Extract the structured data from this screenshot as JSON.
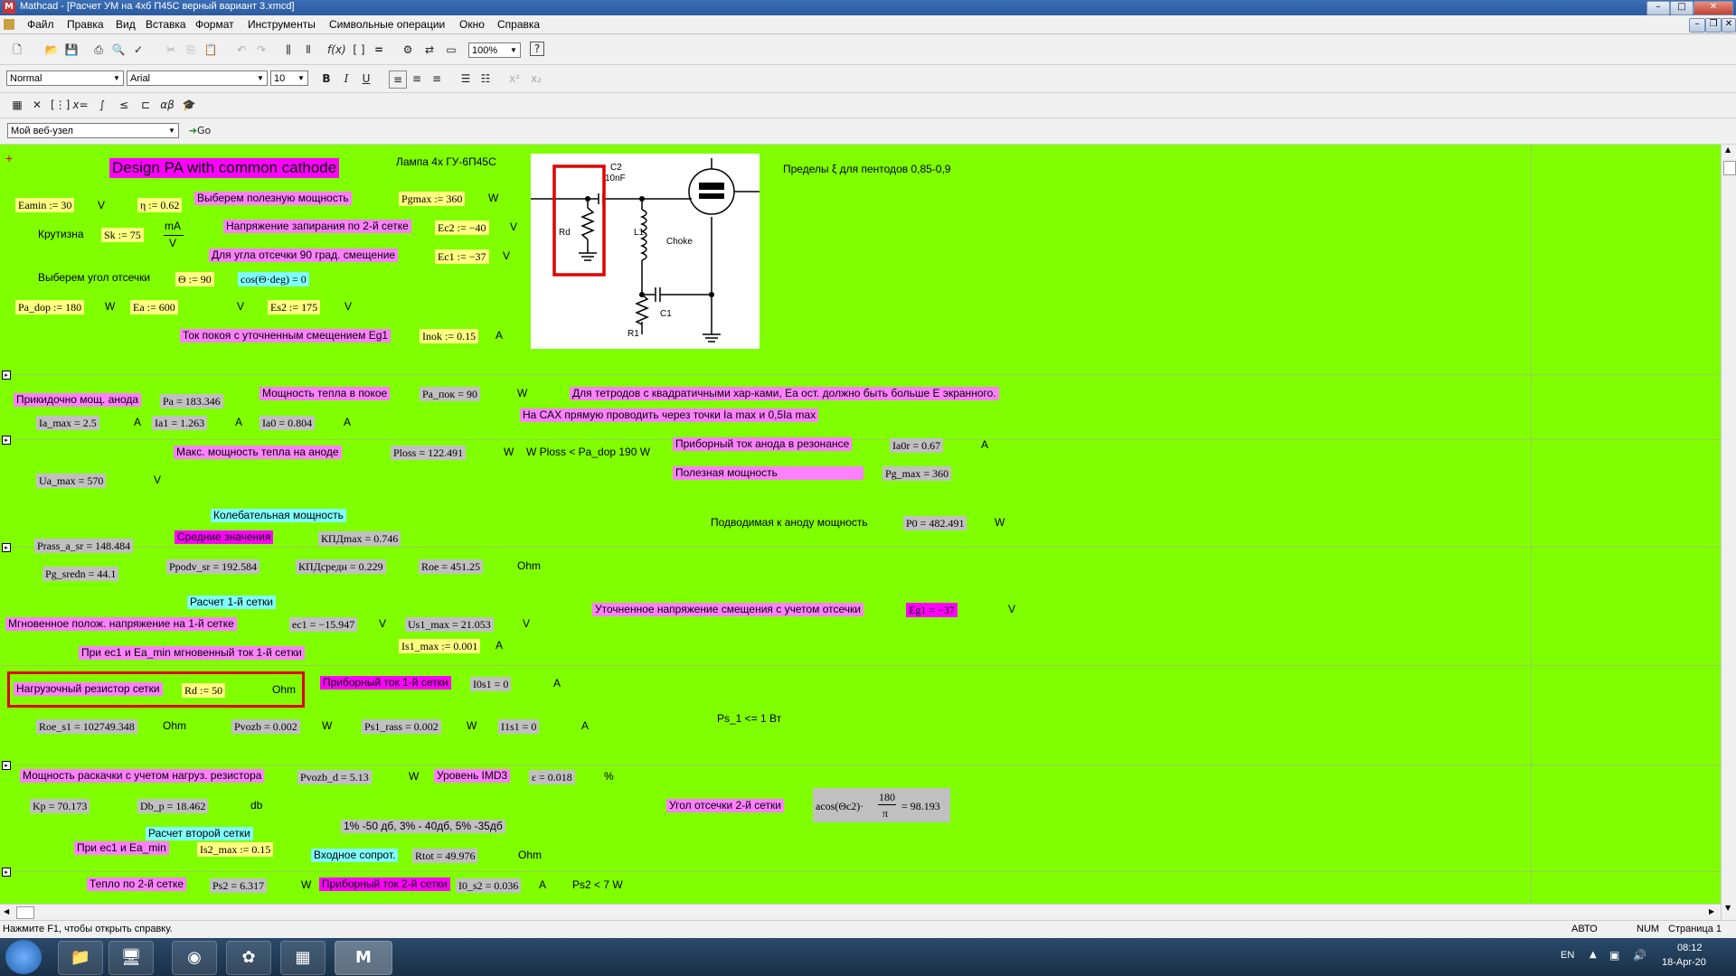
{
  "window": {
    "title": "Mathcad - [Расчет УМ на 4хб П45С  верный вариант 3.xmcd]",
    "app_icon": "mathcad-icon"
  },
  "menu": [
    "Файл",
    "Правка",
    "Вид",
    "Вставка",
    "Формат",
    "Инструменты",
    "Символьные операции",
    "Окно",
    "Справка"
  ],
  "format_toolbar": {
    "style": "Normal",
    "font": "Arial",
    "size": "10",
    "zoom": "100%"
  },
  "web_toolbar": {
    "address": "Мой веб-узел",
    "go_label": "Go"
  },
  "sheet": {
    "title": "Design PA with common cathode",
    "lamp": "Лампа 4х ГУ-6П45С",
    "limits": "Пределы ξ для пентодов  0,85-0,9",
    "row1": {
      "eamin": "Eamin := 30",
      "v1": "V",
      "eta": "η := 0.62",
      "choose_power": "Выберем полезную мощность",
      "pgmax": "Pgmax := 360",
      "w1": "W"
    },
    "row2": {
      "krutizna": "Крутизна",
      "sk": "Sk := 75",
      "unit_num": "mA",
      "unit_den": "V",
      "lock_voltage": "Напряжение запирания по 2-й сетке",
      "ec2": "Ec2 := −40",
      "v2": "V"
    },
    "row3": {
      "bias_90": "Для угла отсечки 90 град. смещение",
      "ec1": "Ec1 := −37",
      "v3": "V"
    },
    "row4": {
      "choose_angle": "Выберем угол отсечки",
      "theta": "Θ := 90",
      "cos": "cos(Θ·deg) = 0"
    },
    "row5": {
      "pa_dop": "Pa_dop := 180",
      "w": "W",
      "ea": "Ea := 600",
      "v": "V",
      "es2": "Es2 := 175",
      "v2": "V"
    },
    "row6": {
      "quiescent": "Ток покоя с уточненным смещением Eg1",
      "inok": "Inok := 0.15",
      "a": "A"
    },
    "sec2": {
      "approx_power": "Прикидочно мощ. анода",
      "pa": "Pa = 183.346",
      "heat_rest": "Мощность тепла в покое",
      "pa_pok": "Pa_пок = 90",
      "w": "W",
      "tetrode_note": "Для тетродов с квадратичными хар-ками, Ea ост. должно быть больше E экранного.",
      "sax_note": "На САХ прямую проводить через точки Ia max  и 0,5Ia max",
      "ia_max": "Ia_max = 2.5",
      "a1": "A",
      "ia1": "Ia1 = 1.263",
      "a2": "A",
      "ia0": "Ia0 = 0.804",
      "a3": "A"
    },
    "sec3": {
      "max_heat": "Макс. мощность тепла на аноде",
      "ploss": "Ploss = 122.491",
      "w": "W",
      "ploss_note": "W  Ploss < Pa_dop 190 W",
      "device_current": "Приборный ток анода  в резонансе",
      "ia0r": "Ia0r = 0.67",
      "a": "A",
      "ua_max": "Ua_max = 570",
      "v": "V",
      "useful_power": "Полезная мощность",
      "pg_max": "Pg_max = 360",
      "osc_power": "Колебательная мощность",
      "supplied_power": "Подводимая к аноду мощность",
      "p0": "P0 = 482.491",
      "w2": "W",
      "avg_values": "Средние значения",
      "prass": "Prass_a_sr = 148.484",
      "kpd_max": "КПДmax = 0.746"
    },
    "sec4": {
      "pg_sredn": "Pg_sredn = 44.1",
      "ppodv": "Ppodv_sr = 192.584",
      "kpd_sredn": "КПДсредн = 0.229",
      "roe": "Roe = 451.25",
      "ohm": "Ohm",
      "calc_grid1": "Расчет 1-й сетки",
      "bias_refined": "Уточненное напряжение смещения с учетом отсечки",
      "eg1": "Eg1 = −37",
      "v": "V",
      "instant_voltage": "Мгновенное полож. напряжение на 1-й сетке",
      "ec1": "ec1 = −15.947",
      "v2": "V",
      "us1_max": "Us1_max = 21.053",
      "v3": "V",
      "instant_current": "При ec1  и Ea_min мгновенный ток 1-й сетки",
      "is1_max": "Is1_max := 0.001",
      "a": "A"
    },
    "sec5": {
      "load_res": "Нагрузочный резистор сетки",
      "rd": "Rd := 50",
      "ohm": "Ohm",
      "device_current1": "Приборный ток 1-й сетки",
      "i0s1": "I0s1 = 0",
      "a": "A",
      "roe_s1": "Roe_s1 = 102749.348",
      "ohm2": "Ohm",
      "pvozb": "Pvozb = 0.002",
      "w": "W",
      "ps1": "Ps1_rass = 0.002",
      "w2": "W",
      "i1s1": "I1s1 = 0",
      "a2": "A",
      "ps_note": "Ps_1 <= 1 Вт"
    },
    "sec6": {
      "drive_power": "Мощность раскачки с учетом нагруз. резистора",
      "pvozb_d": "Pvozb_d = 5.13",
      "w": "W",
      "imd3": "Уровень IMD3",
      "eps": "ε = 0.018",
      "pct": "%",
      "kp": "Kp = 70.173",
      "db_p": "Db_p = 18.462",
      "db": "db",
      "cutoff2": "Угол отсечки 2-й сетки",
      "acos_pre": "acos(Θc2)·",
      "acos_num": "180",
      "acos_den": "π",
      "acos_res": "= 98.193",
      "calc_grid2": "Расчет второй сетки",
      "imd_note": "1% -50 дб, 3% - 40дб, 5% -35дб",
      "at_ec1": "При ec1 и Ea_min",
      "is2_max": "Is2_max := 0.15",
      "input_res": "Входное сопрот.",
      "rtot": "Rtot = 49.976",
      "ohm": "Ohm",
      "heat_g2": "Тепло по 2-й сетке",
      "ps2": "Ps2 = 6.317",
      "w2": "W",
      "device_current2": "Приборный ток 2-й сетки",
      "i0_s2": "I0_s2 = 0.036",
      "a": "A",
      "ps2_note": "Ps2 < 7 W"
    },
    "schematic": {
      "c2": "C2",
      "c2v": "10nF",
      "rd": "Rd",
      "l1": "L1",
      "choke": "Choke",
      "r1": "R1",
      "c1": "C1"
    }
  },
  "status": {
    "hint": "Нажмите F1, чтобы открыть справку.",
    "mode": "АВТО",
    "num": "NUM",
    "page": "Страница 1"
  },
  "taskbar": {
    "lang": "EN",
    "time": "08:12",
    "date": "18-Apr-20"
  }
}
